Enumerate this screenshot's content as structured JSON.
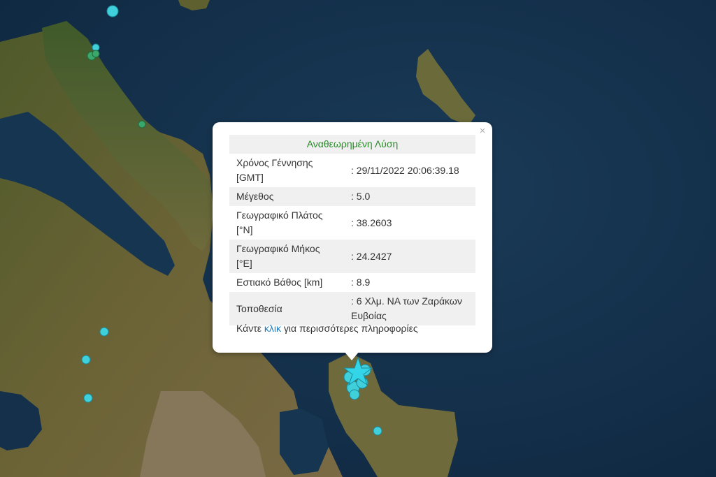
{
  "popup": {
    "header": "Αναθεωρημένη Λύση",
    "close_symbol": "×",
    "rows": [
      {
        "label": "Χρόνος Γέννησης [GMT]",
        "value": ": 29/11/2022 20:06:39.18"
      },
      {
        "label": "Μέγεθος",
        "value": ": 5.0"
      },
      {
        "label": "Γεωγραφικό Πλάτος [°N]",
        "value": ": 38.2603"
      },
      {
        "label": "Γεωγραφικό Μήκος [°E]",
        "value": ": 24.2427"
      },
      {
        "label": "Εστιακό Βάθος [km]",
        "value": ": 8.9"
      },
      {
        "label": "Τοποθεσία",
        "value": ": 6 Χλμ. ΝΑ των Ζαράκων Ευβοίας"
      }
    ],
    "more_info_prefix": "Κάντε ",
    "more_info_link": "κλικ",
    "more_info_suffix": " για περισσότερες πληροφορίες"
  },
  "map": {
    "sea_color": "#14304a",
    "land_color": "#5a5a2e",
    "marker_colors": {
      "cyan": "#3fd0dc",
      "green": "#3aa86a",
      "epicenter": "#33d6e8"
    },
    "marker_icons": [
      "circle-marker",
      "star-marker"
    ]
  }
}
